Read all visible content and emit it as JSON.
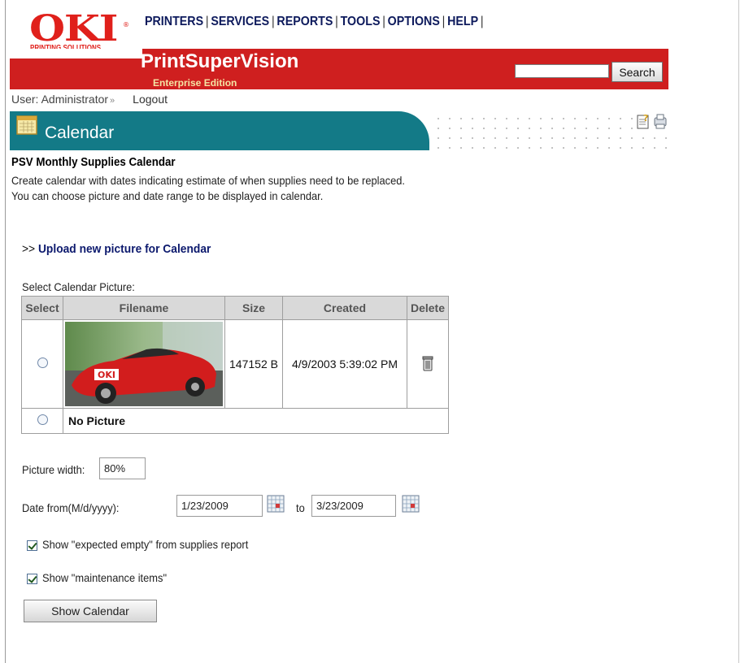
{
  "logo": {
    "brand": "OKI",
    "registered": "®",
    "tagline": "PRINTING SOLUTIONS"
  },
  "nav": {
    "items": [
      "PRINTERS",
      "SERVICES",
      "REPORTS",
      "TOOLS",
      "OPTIONS",
      "HELP"
    ]
  },
  "product": {
    "name": "PrintSuperVision",
    "edition": "Enterprise Edition"
  },
  "search": {
    "value": "",
    "button": "Search"
  },
  "user": {
    "label": "User: Administrator",
    "arrows": "»",
    "logout": "Logout"
  },
  "banner": {
    "title": "Calendar"
  },
  "page": {
    "heading": "PSV Monthly Supplies Calendar",
    "desc_line1": "Create calendar with dates indicating estimate of when supplies need to be replaced.",
    "desc_line2": "You can choose picture and date range to be displayed in calendar.",
    "upload_prefix": ">>",
    "upload_link": "Upload new picture for Calendar",
    "select_label": "Select Calendar Picture:"
  },
  "table": {
    "headers": [
      "Select",
      "Filename",
      "Size",
      "Created",
      "Delete"
    ],
    "rows": [
      {
        "size": "147152 B",
        "created": "4/9/2003 5:39:02 PM"
      }
    ],
    "no_picture": "No Picture"
  },
  "form": {
    "width_label": "Picture width:",
    "width_value": "80%",
    "date_label": "Date from(M/d/yyyy):",
    "date_from": "1/23/2009",
    "to_label": "to",
    "date_to": "3/23/2009",
    "check1": "Show \"expected empty\" from supplies report",
    "check2": "Show \"maintenance items\"",
    "submit": "Show Calendar"
  }
}
